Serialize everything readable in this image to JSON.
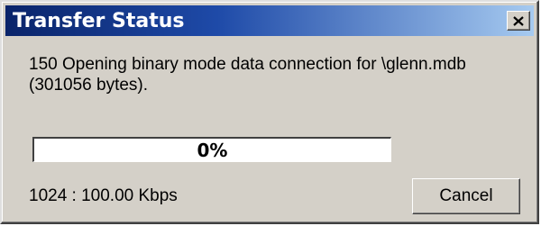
{
  "window": {
    "title": "Transfer Status",
    "close_icon": "close-icon"
  },
  "message": {
    "text": "150 Opening binary mode data connection for \\glenn.mdb (301056 bytes)."
  },
  "progress": {
    "label": "0%",
    "value": 0,
    "fill_color": "#0a246a"
  },
  "status": {
    "rate": "1024 : 100.00 Kbps"
  },
  "buttons": {
    "cancel_label": "Cancel"
  },
  "colors": {
    "title_start": "#0a246a",
    "title_end": "#a6caf0",
    "face": "#d4d0c8"
  }
}
